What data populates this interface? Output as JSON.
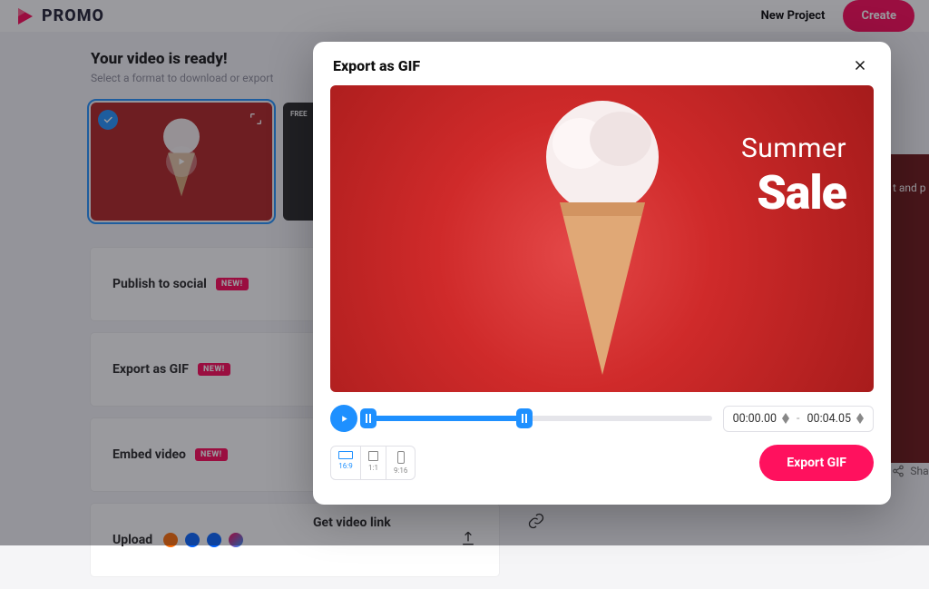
{
  "header": {
    "brand": "PROMO",
    "new_project": "New Project",
    "create": "Create"
  },
  "main": {
    "heading": "Your video is ready!",
    "subheading": "Select a format to download or export",
    "free_badge": "FREE",
    "right_panel_text": "t and p",
    "share": "Share",
    "get_link": "Get video link"
  },
  "actions": {
    "publish": "Publish to social",
    "export_gif": "Export as GIF",
    "embed": "Embed video",
    "upload": "Upload",
    "new_pill": "NEW!"
  },
  "modal": {
    "title": "Export as GIF",
    "preview_line1": "Summer",
    "preview_line2": "Sale",
    "time_start": "00:00.00",
    "time_end": "00:04.05",
    "ratio_169": "16:9",
    "ratio_11": "1:1",
    "ratio_916": "9:16",
    "export_btn": "Export GIF"
  }
}
